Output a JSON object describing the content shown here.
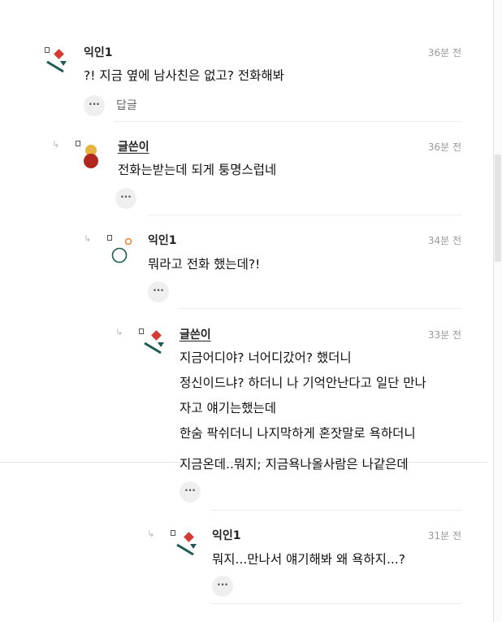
{
  "comments": [
    {
      "author": "익인1",
      "time": "36분 전",
      "lines": [
        "?! 지금 옆에 남사친은 없고? 전화해봐"
      ],
      "more": "···",
      "reply": "답글"
    },
    {
      "author": "글쓴이",
      "time": "36분 전",
      "lines": [
        "전화는받는데 되게 퉁명스럽네"
      ],
      "more": "···"
    },
    {
      "author": "익인1",
      "time": "34분 전",
      "lines": [
        "뭐라고 전화 했는데?!"
      ],
      "more": "···"
    },
    {
      "author": "글쓴이",
      "time": "33분 전",
      "lines": [
        "지금어디야? 너어디갔어? 했더니",
        "정신이드냐? 하더니 나 기억안난다고 일단 만나",
        "자고 얘기는했는데",
        "한숨 팍쉬더니 나지막하게 혼잣말로 욕하더니",
        "지금온데..뭐지; 지금욕나올사람은 나같은데"
      ],
      "more": "···"
    },
    {
      "author": "익인1",
      "time": "31분 전",
      "lines": [
        "뭐지...만나서 얘기해봐 왜 욕하지...?"
      ],
      "more": "···"
    }
  ],
  "icons": {
    "reply_arrow": "reply-arrow-icon",
    "more": "more-icon"
  },
  "colors": {
    "red": "#d43b32",
    "teal": "#1e5a52",
    "yellow": "#e8b33c",
    "darkred": "#b3251f",
    "orange": "#e8873a"
  }
}
